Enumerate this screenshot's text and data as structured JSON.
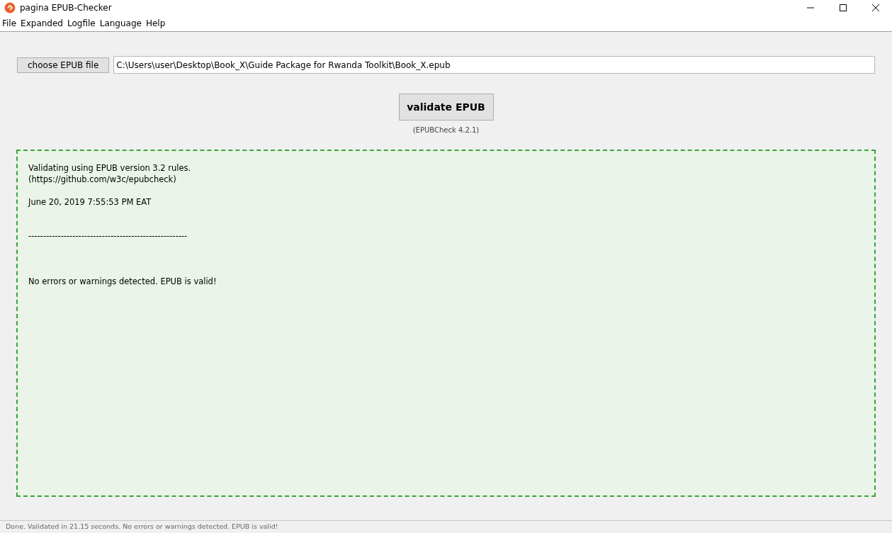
{
  "window": {
    "title": "pagina EPUB-Checker"
  },
  "menu": [
    "File",
    "Expanded",
    "Logfile",
    "Language",
    "Help"
  ],
  "choose_button": "choose EPUB file",
  "file_path": {
    "value": "C:\\Users\\user\\Desktop\\Book_X\\Guide Package for Rwanda Toolkit\\Book_X.epub"
  },
  "validate_button": "validate EPUB",
  "version": "(EPUBCheck 4.2.1)",
  "log": {
    "valid": true,
    "blocks": [
      [
        "Validating using EPUB version 3.2 rules.",
        "(https://github.com/w3c/epubcheck)"
      ],
      [
        "June 20, 2019 7:55:53 PM EAT"
      ],
      [
        "------------------------------------------------------"
      ],
      [
        "No errors or warnings detected. EPUB is valid!"
      ]
    ]
  },
  "status_bar": "Done. Validated in 21.15 seconds. No errors or warnings detected. EPUB is valid!"
}
